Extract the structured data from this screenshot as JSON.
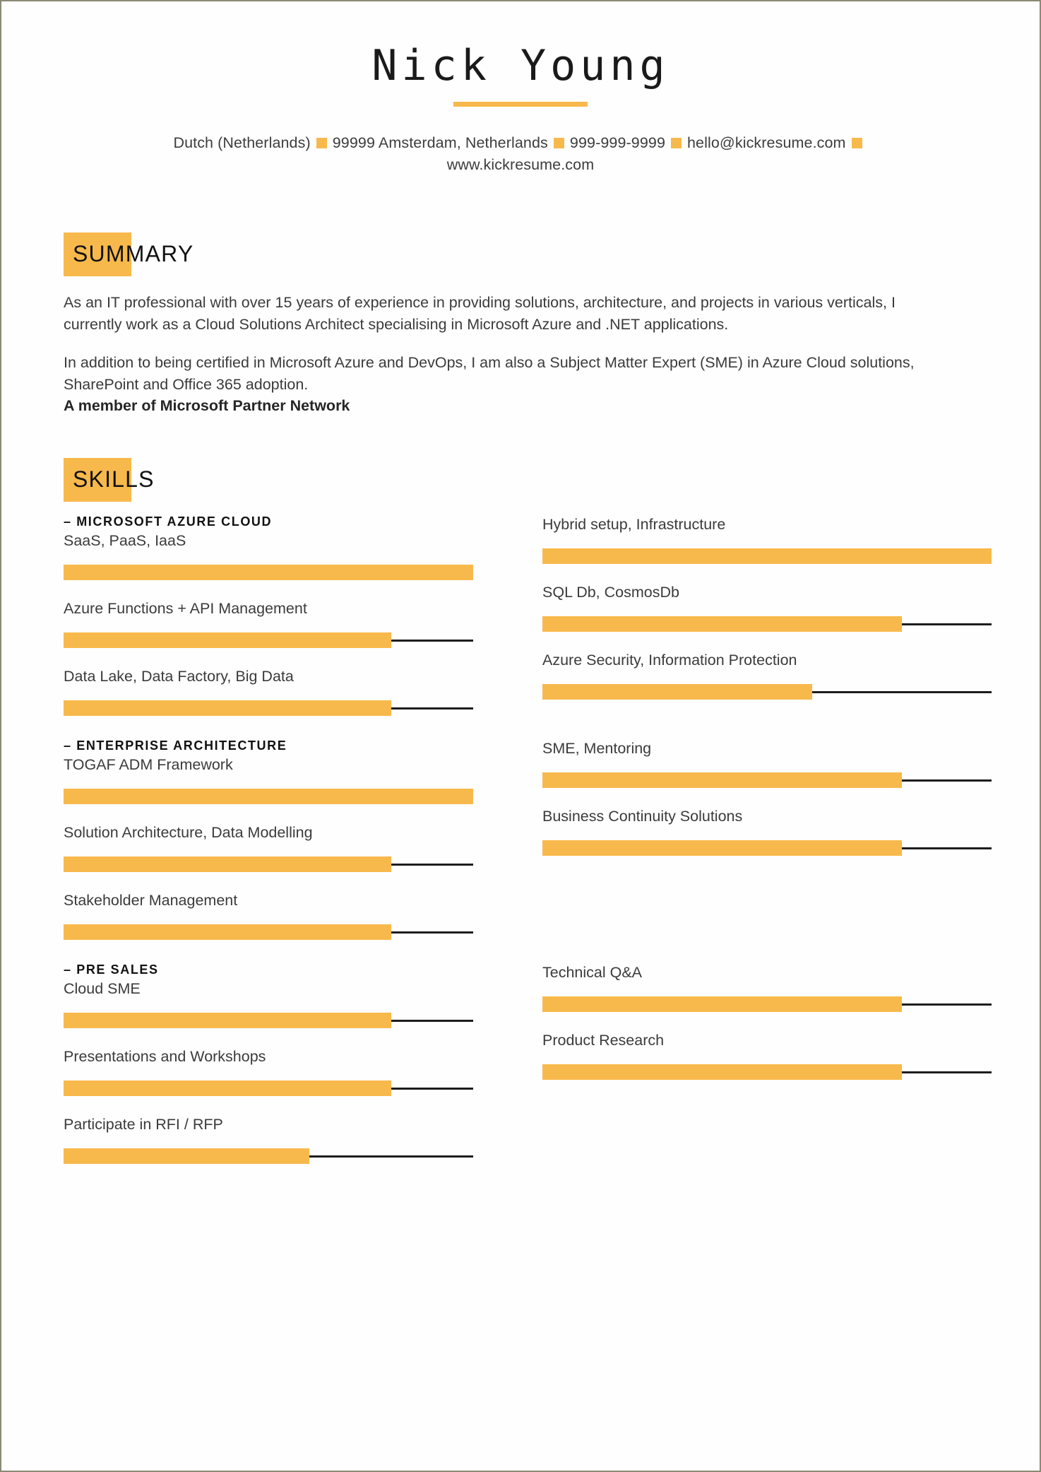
{
  "theme": {
    "accent": "#f8b94c",
    "text": "#3b3b3b",
    "heading": "#111111",
    "rule": "#1d1d1d",
    "page_border": "#8a8a76"
  },
  "header": {
    "name": "Nick Young",
    "contact": [
      "Dutch (Netherlands)",
      "99999 Amsterdam, Netherlands",
      "999-999-9999",
      "hello@kickresume.com",
      "www.kickresume.com"
    ]
  },
  "sections": {
    "summary": {
      "title": "SUMMARY",
      "paragraphs": [
        "As an IT professional with over 15 years of experience in providing solutions, architecture, and projects in various verticals, I currently work as a Cloud Solutions Architect specialising in Microsoft Azure and .NET applications.",
        "In addition to being certified in Microsoft Azure and DevOps, I am also a Subject Matter Expert (SME) in Azure Cloud solutions, SharePoint and Office 365 adoption."
      ],
      "bold_line": "A member of Microsoft Partner Network"
    },
    "skills": {
      "title": "SKILLS",
      "groups": [
        {
          "name": "– MICROSOFT AZURE CLOUD",
          "left": [
            {
              "label": "SaaS, PaaS, IaaS",
              "level": 100
            },
            {
              "label": "Azure Functions + API Management",
              "level": 80
            },
            {
              "label": "Data Lake, Data Factory, Big Data",
              "level": 80
            }
          ],
          "right": [
            {
              "label": "Hybrid setup, Infrastructure",
              "level": 100
            },
            {
              "label": "SQL Db, CosmosDb",
              "level": 80
            },
            {
              "label": "Azure Security, Information Protection",
              "level": 60
            }
          ]
        },
        {
          "name": "– ENTERPRISE ARCHITECTURE",
          "left": [
            {
              "label": "TOGAF ADM Framework",
              "level": 100
            },
            {
              "label": "Solution Architecture, Data Modelling",
              "level": 80
            },
            {
              "label": "Stakeholder Management",
              "level": 80
            }
          ],
          "right": [
            {
              "label": "SME, Mentoring",
              "level": 80
            },
            {
              "label": "Business Continuity Solutions",
              "level": 80
            }
          ]
        },
        {
          "name": "– PRE SALES",
          "left": [
            {
              "label": "Cloud SME",
              "level": 80
            },
            {
              "label": "Presentations and Workshops",
              "level": 80
            },
            {
              "label": "Participate in RFI / RFP",
              "level": 60
            }
          ],
          "right": [
            {
              "label": "Technical Q&A",
              "level": 80
            },
            {
              "label": "Product Research",
              "level": 80
            }
          ]
        }
      ]
    }
  }
}
